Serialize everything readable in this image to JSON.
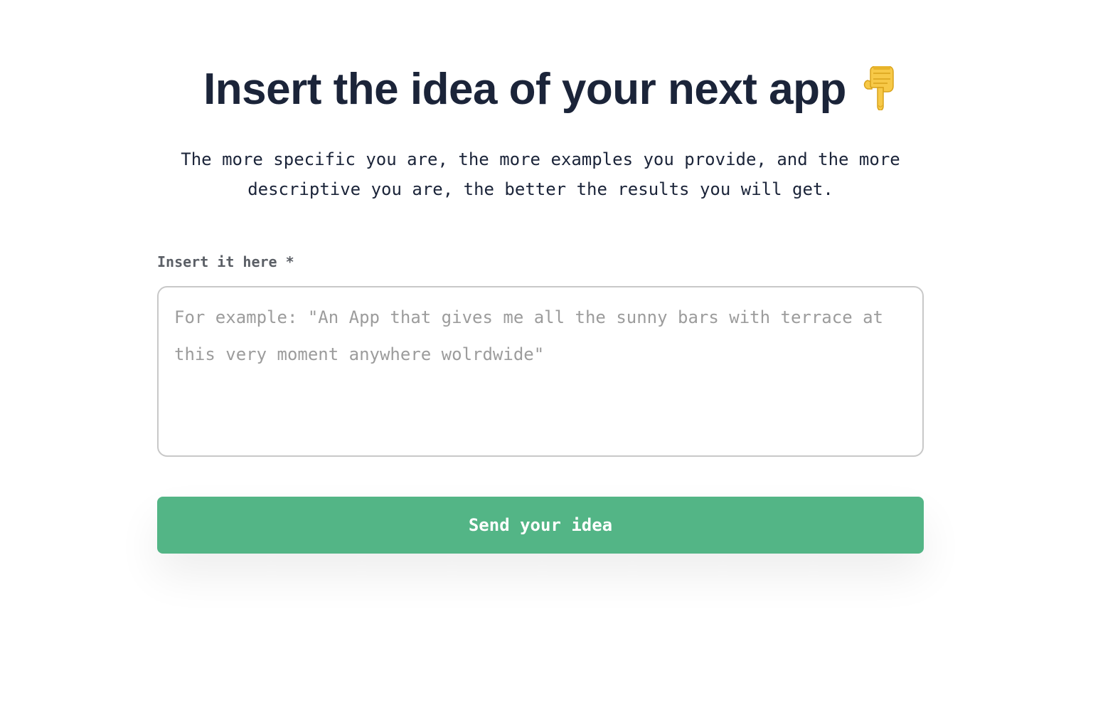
{
  "header": {
    "title": "Insert the idea of your next app",
    "icon": "backhand-index-pointing-down-icon",
    "subtitle": "The more specific you are, the more examples you provide, and the more descriptive you are, the better the results you will get."
  },
  "form": {
    "label": "Insert it here *",
    "placeholder": "For example: \"An App that gives me all the sunny bars with terrace at this very moment anywhere wolrdwide\"",
    "value": "",
    "submit_label": "Send your idea"
  },
  "colors": {
    "title": "#1b2439",
    "accent": "#53b586",
    "label": "#5b5f66",
    "placeholder": "#9c9c9c",
    "border": "#c8c8c8"
  }
}
